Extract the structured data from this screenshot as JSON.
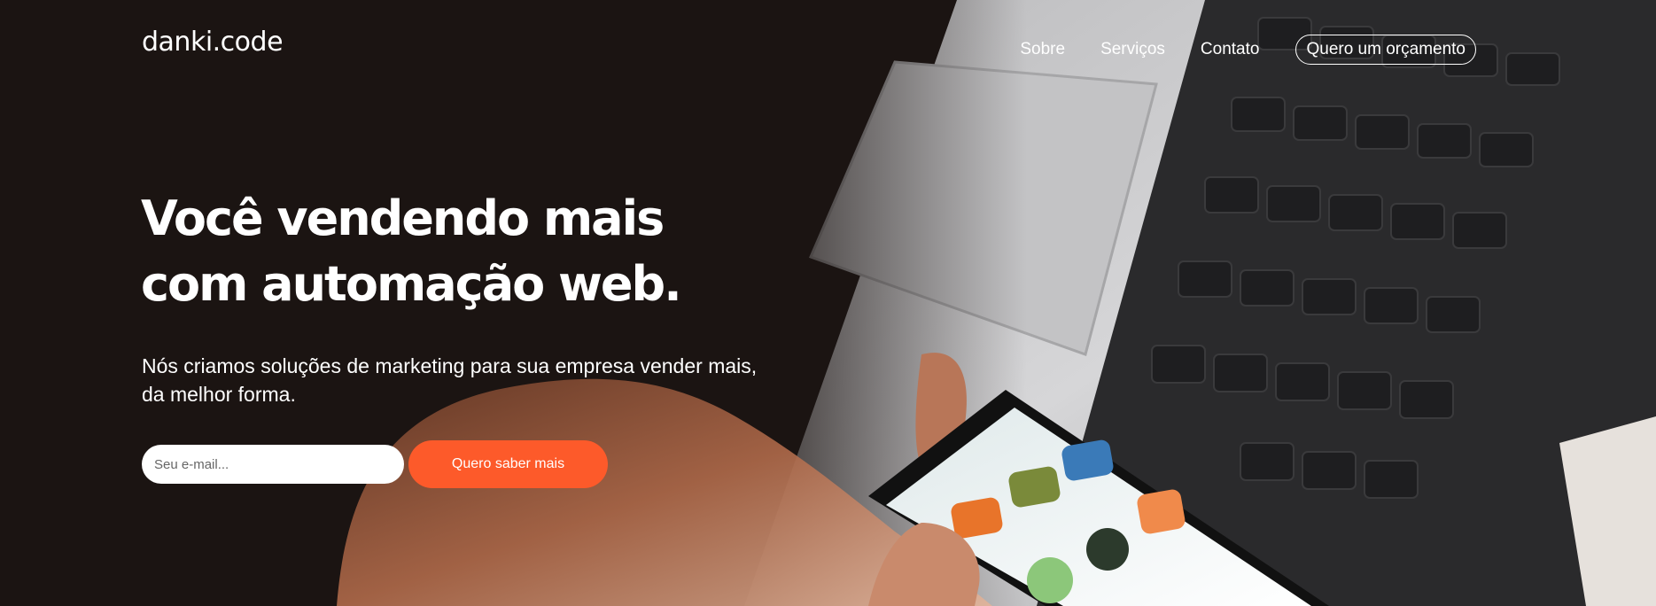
{
  "header": {
    "logo": "danki.code",
    "nav": {
      "about": "Sobre",
      "services": "Serviços",
      "contact": "Contato",
      "quote": "Quero um orçamento"
    }
  },
  "hero": {
    "headline_line1": "Você vendendo mais",
    "headline_line2": "com automação web.",
    "subheadline": "Nós criamos soluções de marketing para sua empresa vender mais, da melhor forma.",
    "email_placeholder": "Seu e-mail...",
    "cta_label": "Quero saber mais"
  },
  "colors": {
    "accent": "#fd5a2a",
    "background": "#1b1412",
    "text": "#ffffff"
  },
  "icons": {
    "background": "hero-photo-hand-phone-laptop"
  }
}
